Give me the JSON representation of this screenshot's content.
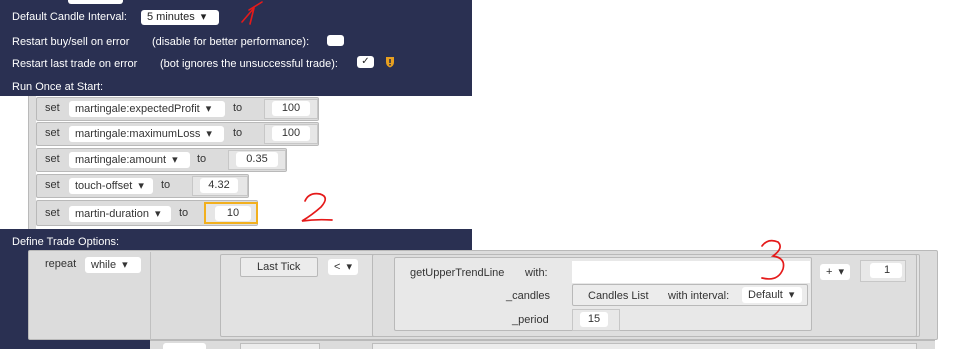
{
  "settings": {
    "default_candle_interval_label": "Default Candle Interval:",
    "default_candle_interval_value": "5 minutes",
    "restart_buysell_label": "Restart buy/sell on error",
    "restart_buysell_note": "(disable for better performance):",
    "restart_buysell_checked": false,
    "restart_last_trade_label": "Restart last trade on error",
    "restart_last_trade_note": "(bot ignores the unsuccessful trade):",
    "restart_last_trade_checked": true,
    "checkmark": "✓"
  },
  "run_once": {
    "title": "Run Once at Start:",
    "rows": [
      {
        "set": "set",
        "var": "martingale:expectedProfit",
        "to": "to",
        "value": "100"
      },
      {
        "set": "set",
        "var": "martingale:maximumLoss",
        "to": "to",
        "value": "100"
      },
      {
        "set": "set",
        "var": "martingale:amount",
        "to": "to",
        "value": "0.35"
      },
      {
        "set": "set",
        "var": "touch-offset",
        "to": "to",
        "value": "4.32"
      },
      {
        "set": "set",
        "var": "martin-duration",
        "to": "to",
        "value": "10"
      }
    ]
  },
  "trade_options": {
    "title": "Define Trade Options:",
    "repeat": "repeat",
    "while": "while",
    "last_tick": "Last Tick",
    "operator": "<",
    "func": "getUpperTrendLine",
    "with": "with:",
    "candles_label": "_candles",
    "candles_list": "Candles List",
    "with_interval": "with interval:",
    "interval_value": "Default",
    "period_label": "_period",
    "period_value": "15",
    "plus_op": "+",
    "plus_value": "1"
  },
  "annotations": {
    "one": "1",
    "two": "2",
    "three": "3"
  },
  "colors": {
    "navy": "#2a3052",
    "block": "#dcdcdc",
    "highlight": "#f2b01e",
    "annotation": "#e51a1a",
    "warning": "#e8a020"
  },
  "dropdown_arrow": "▾"
}
